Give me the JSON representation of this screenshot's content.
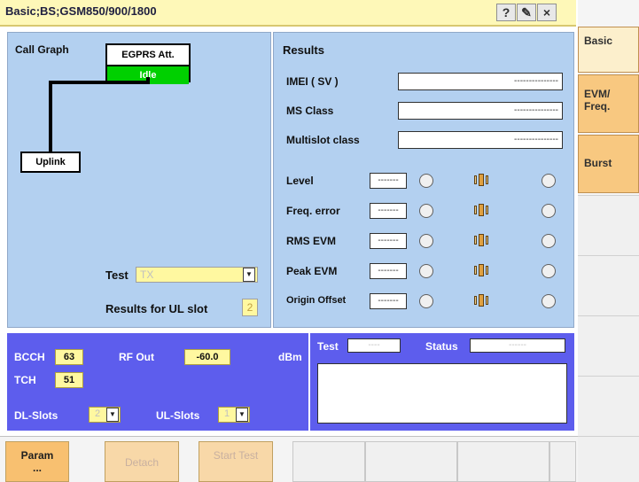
{
  "window": {
    "title": "Basic;BS;GSM850/900/1800",
    "help_glyph": "?",
    "settings_glyph": "✎",
    "close_glyph": "×"
  },
  "call_graph": {
    "label": "Call Graph",
    "state_title": "EGPRS Att.",
    "state_value": "Idle",
    "uplink": "Uplink"
  },
  "test_select": {
    "label": "Test",
    "value": "TX"
  },
  "ul_slot": {
    "label": "Results for UL slot",
    "value": "2"
  },
  "results": {
    "title": "Results",
    "imei_label": "IMEI ( SV )",
    "imei_value": "---------------",
    "ms_class_label": "MS Class",
    "ms_class_value": "---------------",
    "multislot_label": "Multislot class",
    "multislot_value": "---------------",
    "meters": [
      {
        "label": "Level",
        "value": "-------"
      },
      {
        "label": "Freq. error",
        "value": "-------"
      },
      {
        "label": "RMS EVM",
        "value": "-------"
      },
      {
        "label": "Peak EVM",
        "value": "-------"
      },
      {
        "label": "Origin Offset",
        "value": "-------"
      }
    ]
  },
  "settings": {
    "bcch_label": "BCCH",
    "bcch_value": "63",
    "rfout_label": "RF Out",
    "rfout_value": "-60.0",
    "rfout_unit": "dBm",
    "tch_label": "TCH",
    "tch_value": "51",
    "dl_slots_label": "DL-Slots",
    "dl_slots_value": "2",
    "ul_slots_label": "UL-Slots",
    "ul_slots_value": "1"
  },
  "status_panel": {
    "test_label": "Test",
    "test_value": "----",
    "status_label": "Status",
    "status_value": "------"
  },
  "right_tabs": [
    "Basic",
    "EVM/ Freq.",
    "Burst"
  ],
  "softkeys": {
    "param": "Param",
    "param_sub": "...",
    "detach": "Detach",
    "start_test": "Start Test"
  },
  "colors": {
    "panel": "#b3d0f0",
    "settings_panel": "#5d5ded",
    "tab_active": "#f8c880",
    "title_bar": "#fef8b8",
    "idle_green": "#00d000"
  }
}
